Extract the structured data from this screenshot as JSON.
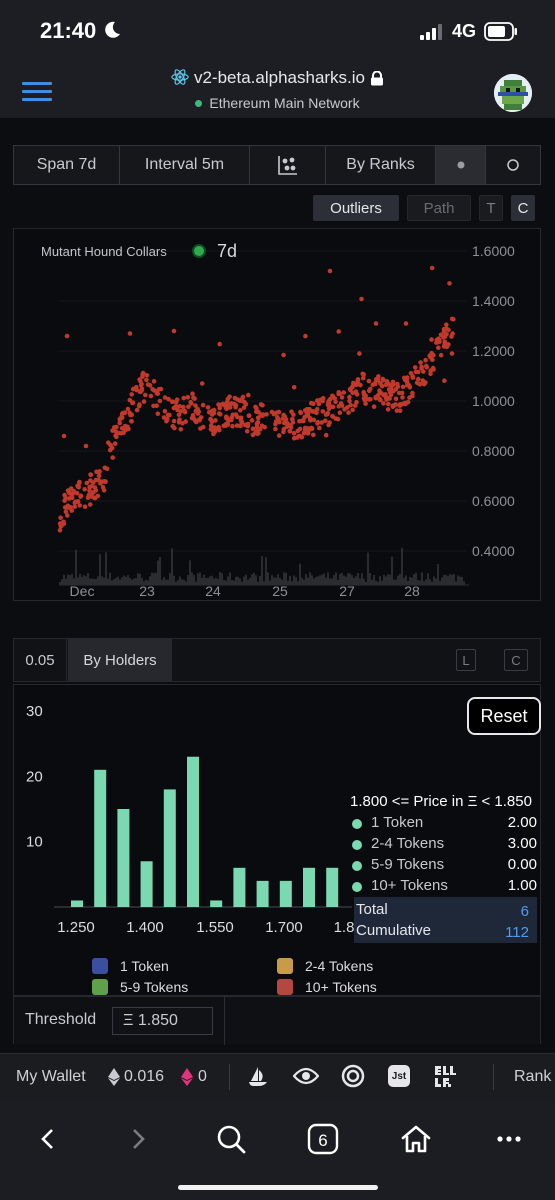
{
  "status_bar": {
    "time": "21:40",
    "network": "4G"
  },
  "browser": {
    "url": "v2-beta.alphasharks.io",
    "network_label": "Ethereum Main Network"
  },
  "toolbar": {
    "span": "Span 7d",
    "interval": "Interval 5m",
    "by_ranks": "By Ranks"
  },
  "subtoolbar": {
    "outliers": "Outliers",
    "path": "Path",
    "t": "T",
    "c": "C"
  },
  "scatter_chart": {
    "collection": "Mutant Hound Collars",
    "span_label": "7d",
    "status_color": "#2fa84f",
    "point_color": "#c0392b",
    "y_ticks": [
      "1.6000",
      "1.4000",
      "1.2000",
      "1.0000",
      "0.8000",
      "0.6000",
      "0.4000"
    ],
    "x_ticks": [
      "Dec",
      "23",
      "24",
      "25",
      "27",
      "28"
    ]
  },
  "holders": {
    "threshold_value": "0.05",
    "by_holders": "By Holders",
    "l": "L",
    "c": "C",
    "reset": "Reset"
  },
  "chart_data": {
    "type": "bar",
    "categories": [
      "1.250",
      "1.300",
      "1.350",
      "1.400",
      "1.450",
      "1.500",
      "1.550",
      "1.600",
      "1.650",
      "1.700",
      "1.750",
      "1.800"
    ],
    "values": [
      1,
      21,
      15,
      7,
      18,
      23,
      1,
      6,
      4,
      4,
      6,
      6
    ],
    "x_tick_labels": [
      "1.250",
      "1.400",
      "1.550",
      "1.700",
      "1.8"
    ],
    "y_tick_labels": [
      "30",
      "20",
      "10"
    ],
    "ylim": [
      0,
      30
    ],
    "bar_color": "#7ad9b0",
    "legend": [
      "1 Token",
      "2-4 Tokens",
      "5-9 Tokens",
      "10+ Tokens"
    ],
    "legend_colors": [
      "#3b4f9e",
      "#c99a4a",
      "#5fa14a",
      "#b4473f"
    ]
  },
  "tooltip": {
    "title": "1.800 <= Price in Ξ < 1.850",
    "rows": [
      {
        "label": "1 Token",
        "value": "2.00"
      },
      {
        "label": "2-4 Tokens",
        "value": "3.00"
      },
      {
        "label": "5-9 Tokens",
        "value": "0.00"
      },
      {
        "label": "10+ Tokens",
        "value": "1.00"
      }
    ],
    "total_label": "Total",
    "total_value": "6",
    "cumulative_label": "Cumulative",
    "cumulative_value": "112"
  },
  "threshold": {
    "label": "Threshold",
    "input": "Ξ 1.850"
  },
  "wallet": {
    "label": "My Wallet",
    "eth": "0.016",
    "weth": "0",
    "rank": "Rank",
    "sudo_label": "Jst"
  }
}
